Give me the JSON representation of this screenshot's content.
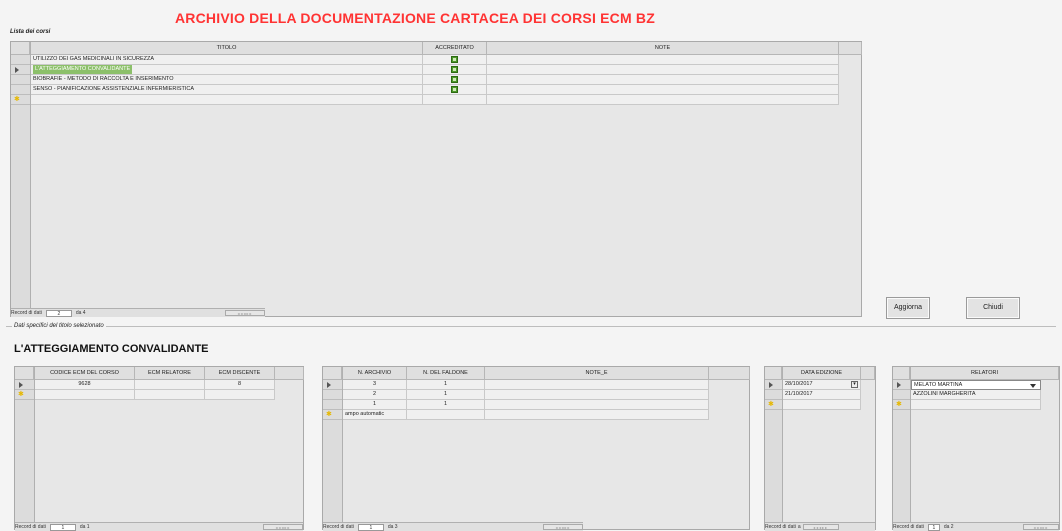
{
  "window": {
    "title": "ARCHIVIO DELLA DOCUMENTAZIONE CARTACEA DEI CORSI ECM BZ",
    "list_label": "Lista dei corsi",
    "details_label": "Dati specifici del titolo selezionato",
    "selected_title": "L'ATTEGGIAMENTO CONVALIDANTE"
  },
  "courses": {
    "headers": [
      "TITOLO",
      "ACCREDITATO",
      "NOTE"
    ],
    "rows": [
      {
        "title": "UTILIZZO DEI GAS MEDICINALI IN SICUREZZA",
        "accredited": true,
        "note": ""
      },
      {
        "title": "L'ATTEGGIAMENTO CONVALIDANTE",
        "accredited": true,
        "note": ""
      },
      {
        "title": "BIOBRAFIE - METODO DI RACCOLTA E INSERIMENTO",
        "accredited": true,
        "note": ""
      },
      {
        "title": "SENSO - PIANIFICAZIONE ASSISTENZIALE INFERMIERISTICA",
        "accredited": true,
        "note": ""
      }
    ],
    "nav": {
      "label": "Record di dati",
      "current": "2",
      "of_label": "da 4"
    }
  },
  "buttons": {
    "update": "Aggiorna",
    "close": "Chiudi"
  },
  "ecm": {
    "headers": [
      "CODICE ECM DEL CORSO",
      "ECM RELATORE",
      "ECM DISCENTE"
    ],
    "rows": [
      {
        "code": "9628",
        "relatore": "",
        "discente": "8"
      }
    ],
    "nav": {
      "label": "Record di dati",
      "current": "1",
      "of_label": "da 1"
    }
  },
  "archive": {
    "headers": [
      "N. ARCHIVIO",
      "N. DEL FALDONE",
      "NOTE_E"
    ],
    "rows": [
      {
        "archivio": "3",
        "faldone": "1",
        "note": ""
      },
      {
        "archivio": "2",
        "faldone": "1",
        "note": ""
      },
      {
        "archivio": "1",
        "faldone": "1",
        "note": ""
      }
    ],
    "new_row": "ampo automatic",
    "nav": {
      "label": "Record di dati",
      "current": "1",
      "of_label": "da 3"
    }
  },
  "editions": {
    "headers": [
      "DATA EDIZIONE"
    ],
    "rows": [
      "28/10/2017",
      "21/10/2017"
    ],
    "nav": {
      "label": "Record di dati",
      "current": "a",
      "of_label": ""
    }
  },
  "speakers": {
    "headers": [
      "RELATORI"
    ],
    "rows": [
      "MELATO MARTINA",
      "AZZOLINI MARGHERITA"
    ],
    "nav": {
      "label": "Record di dati",
      "current": "1",
      "of_label": "da 2"
    }
  },
  "colors": {
    "title": "#ff3333",
    "highlight": "#8cc06a",
    "check": "#4d9a2a"
  }
}
